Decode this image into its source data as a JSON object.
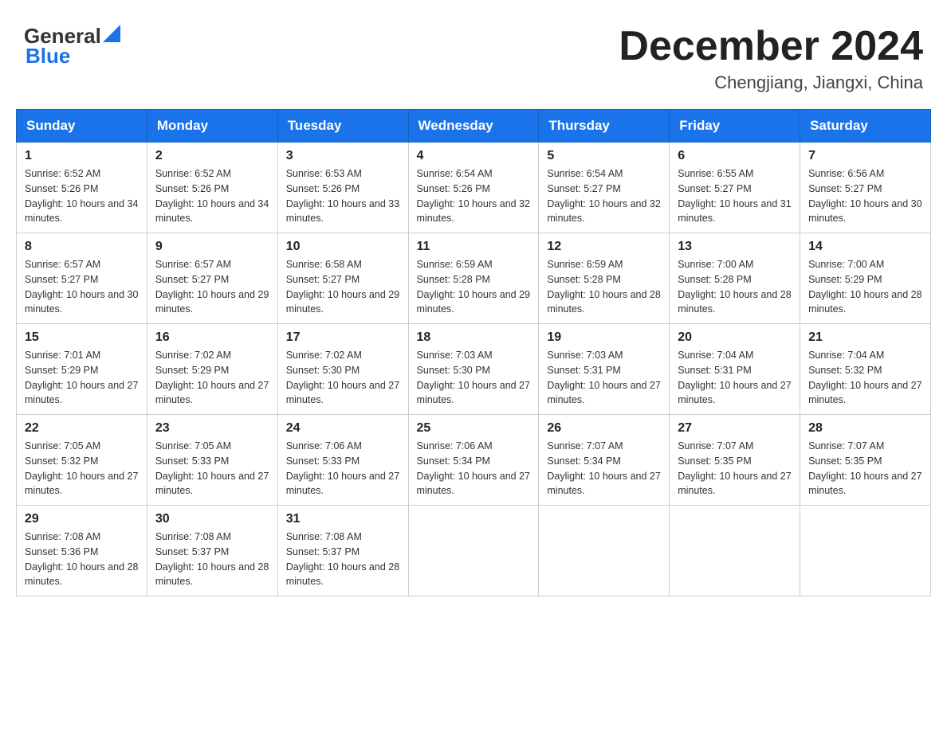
{
  "header": {
    "logo_general": "General",
    "logo_blue": "Blue",
    "month_title": "December 2024",
    "location": "Chengjiang, Jiangxi, China"
  },
  "days_of_week": [
    "Sunday",
    "Monday",
    "Tuesday",
    "Wednesday",
    "Thursday",
    "Friday",
    "Saturday"
  ],
  "weeks": [
    [
      {
        "day": "1",
        "sunrise": "6:52 AM",
        "sunset": "5:26 PM",
        "daylight": "10 hours and 34 minutes."
      },
      {
        "day": "2",
        "sunrise": "6:52 AM",
        "sunset": "5:26 PM",
        "daylight": "10 hours and 34 minutes."
      },
      {
        "day": "3",
        "sunrise": "6:53 AM",
        "sunset": "5:26 PM",
        "daylight": "10 hours and 33 minutes."
      },
      {
        "day": "4",
        "sunrise": "6:54 AM",
        "sunset": "5:26 PM",
        "daylight": "10 hours and 32 minutes."
      },
      {
        "day": "5",
        "sunrise": "6:54 AM",
        "sunset": "5:27 PM",
        "daylight": "10 hours and 32 minutes."
      },
      {
        "day": "6",
        "sunrise": "6:55 AM",
        "sunset": "5:27 PM",
        "daylight": "10 hours and 31 minutes."
      },
      {
        "day": "7",
        "sunrise": "6:56 AM",
        "sunset": "5:27 PM",
        "daylight": "10 hours and 30 minutes."
      }
    ],
    [
      {
        "day": "8",
        "sunrise": "6:57 AM",
        "sunset": "5:27 PM",
        "daylight": "10 hours and 30 minutes."
      },
      {
        "day": "9",
        "sunrise": "6:57 AM",
        "sunset": "5:27 PM",
        "daylight": "10 hours and 29 minutes."
      },
      {
        "day": "10",
        "sunrise": "6:58 AM",
        "sunset": "5:27 PM",
        "daylight": "10 hours and 29 minutes."
      },
      {
        "day": "11",
        "sunrise": "6:59 AM",
        "sunset": "5:28 PM",
        "daylight": "10 hours and 29 minutes."
      },
      {
        "day": "12",
        "sunrise": "6:59 AM",
        "sunset": "5:28 PM",
        "daylight": "10 hours and 28 minutes."
      },
      {
        "day": "13",
        "sunrise": "7:00 AM",
        "sunset": "5:28 PM",
        "daylight": "10 hours and 28 minutes."
      },
      {
        "day": "14",
        "sunrise": "7:00 AM",
        "sunset": "5:29 PM",
        "daylight": "10 hours and 28 minutes."
      }
    ],
    [
      {
        "day": "15",
        "sunrise": "7:01 AM",
        "sunset": "5:29 PM",
        "daylight": "10 hours and 27 minutes."
      },
      {
        "day": "16",
        "sunrise": "7:02 AM",
        "sunset": "5:29 PM",
        "daylight": "10 hours and 27 minutes."
      },
      {
        "day": "17",
        "sunrise": "7:02 AM",
        "sunset": "5:30 PM",
        "daylight": "10 hours and 27 minutes."
      },
      {
        "day": "18",
        "sunrise": "7:03 AM",
        "sunset": "5:30 PM",
        "daylight": "10 hours and 27 minutes."
      },
      {
        "day": "19",
        "sunrise": "7:03 AM",
        "sunset": "5:31 PM",
        "daylight": "10 hours and 27 minutes."
      },
      {
        "day": "20",
        "sunrise": "7:04 AM",
        "sunset": "5:31 PM",
        "daylight": "10 hours and 27 minutes."
      },
      {
        "day": "21",
        "sunrise": "7:04 AM",
        "sunset": "5:32 PM",
        "daylight": "10 hours and 27 minutes."
      }
    ],
    [
      {
        "day": "22",
        "sunrise": "7:05 AM",
        "sunset": "5:32 PM",
        "daylight": "10 hours and 27 minutes."
      },
      {
        "day": "23",
        "sunrise": "7:05 AM",
        "sunset": "5:33 PM",
        "daylight": "10 hours and 27 minutes."
      },
      {
        "day": "24",
        "sunrise": "7:06 AM",
        "sunset": "5:33 PM",
        "daylight": "10 hours and 27 minutes."
      },
      {
        "day": "25",
        "sunrise": "7:06 AM",
        "sunset": "5:34 PM",
        "daylight": "10 hours and 27 minutes."
      },
      {
        "day": "26",
        "sunrise": "7:07 AM",
        "sunset": "5:34 PM",
        "daylight": "10 hours and 27 minutes."
      },
      {
        "day": "27",
        "sunrise": "7:07 AM",
        "sunset": "5:35 PM",
        "daylight": "10 hours and 27 minutes."
      },
      {
        "day": "28",
        "sunrise": "7:07 AM",
        "sunset": "5:35 PM",
        "daylight": "10 hours and 27 minutes."
      }
    ],
    [
      {
        "day": "29",
        "sunrise": "7:08 AM",
        "sunset": "5:36 PM",
        "daylight": "10 hours and 28 minutes."
      },
      {
        "day": "30",
        "sunrise": "7:08 AM",
        "sunset": "5:37 PM",
        "daylight": "10 hours and 28 minutes."
      },
      {
        "day": "31",
        "sunrise": "7:08 AM",
        "sunset": "5:37 PM",
        "daylight": "10 hours and 28 minutes."
      },
      null,
      null,
      null,
      null
    ]
  ]
}
